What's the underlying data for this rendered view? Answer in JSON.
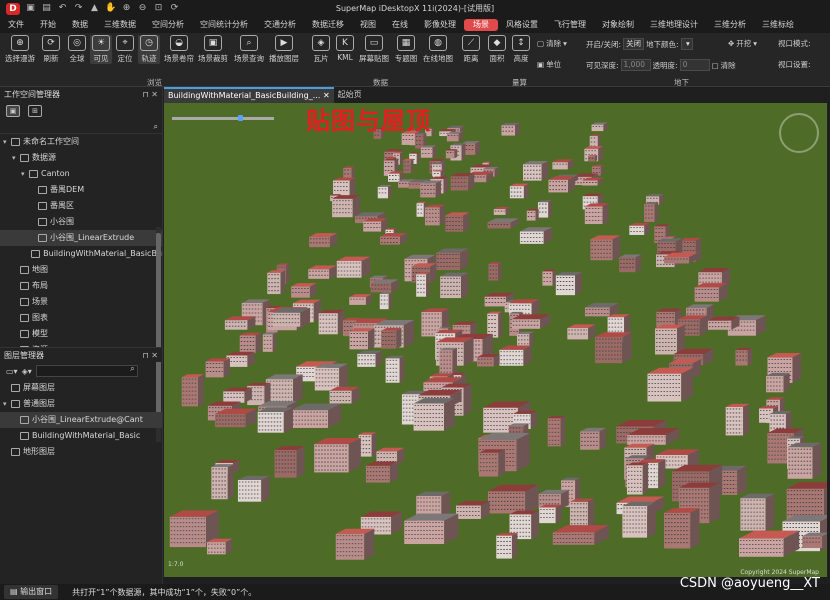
{
  "window": {
    "title": "SuperMap iDesktopX 11i(2024)-[试用版]",
    "logo": "D"
  },
  "quick_access": [
    "save-icon",
    "open-icon",
    "undo-icon",
    "redo-icon",
    "select-icon",
    "pan-icon",
    "zoom-in-icon",
    "zoom-out-icon",
    "fit-icon",
    "refresh-icon"
  ],
  "menu": [
    "文件",
    "开始",
    "数据",
    "三维数据",
    "空间分析",
    "空间统计分析",
    "交通分析",
    "数据迁移",
    "视图",
    "在线",
    "影像处理",
    "场景",
    "风格设置",
    "飞行管理",
    "对象绘制",
    "三维地理设计",
    "三维分析",
    "三维标绘"
  ],
  "active_menu": "场景",
  "ribbon": {
    "buttons": [
      "选择漫游",
      "刷新",
      "全球",
      "可见",
      "定位",
      "轨迹",
      "场景卷帘",
      "场景裁剪",
      "场景查询",
      "播放图层",
      "瓦片",
      "KML",
      "屏幕贴图",
      "专题图",
      "在线地图",
      "距离",
      "面积",
      "高度"
    ],
    "small": {
      "clear": "清除",
      "unit": "单位",
      "open_close_label": "开启/关闭:",
      "open_close_value": "关闭",
      "underground_color": "地下颜色:",
      "open": "开挖",
      "visible_depth": "可见深度:",
      "depth_value": "1,000",
      "transparency": "透明度:",
      "trans_value": "0",
      "clear2": "清除",
      "viewport_mode": "视口模式:",
      "viewport_setting": "视口设置:"
    },
    "groups": [
      "浏览",
      "数据",
      "量算",
      "地下"
    ]
  },
  "workspace": {
    "title": "工作空间管理器",
    "items": [
      {
        "label": "未命名工作空间",
        "level": 0,
        "arrow": "▾"
      },
      {
        "label": "数据源",
        "level": 1,
        "arrow": "▾"
      },
      {
        "label": "Canton",
        "level": 2,
        "arrow": "▾"
      },
      {
        "label": "番禺DEM",
        "level": 3,
        "arrow": ""
      },
      {
        "label": "番禺区",
        "level": 3,
        "arrow": ""
      },
      {
        "label": "小谷围",
        "level": 3,
        "arrow": ""
      },
      {
        "label": "小谷围_LinearExtrude",
        "level": 3,
        "arrow": "",
        "selected": true
      },
      {
        "label": "BuildingWithMaterial_BasicBu",
        "level": 3,
        "arrow": ""
      },
      {
        "label": "地图",
        "level": 1,
        "arrow": ""
      },
      {
        "label": "布局",
        "level": 1,
        "arrow": ""
      },
      {
        "label": "场景",
        "level": 1,
        "arrow": ""
      },
      {
        "label": "图表",
        "level": 1,
        "arrow": ""
      },
      {
        "label": "模型",
        "level": 1,
        "arrow": ""
      },
      {
        "label": "资源",
        "level": 1,
        "arrow": ""
      }
    ]
  },
  "layers": {
    "title": "图层管理器",
    "items": [
      {
        "label": "屏幕图层",
        "level": 0,
        "arrow": ""
      },
      {
        "label": "普通图层",
        "level": 0,
        "arrow": "▾"
      },
      {
        "label": "小谷围_LinearExtrude@Cant",
        "level": 1,
        "arrow": "",
        "selected": true
      },
      {
        "label": "BuildingWithMaterial_Basic",
        "level": 1,
        "arrow": ""
      },
      {
        "label": "地形图层",
        "level": 0,
        "arrow": ""
      }
    ]
  },
  "tabs": [
    "BuildingWithMaterial_BasicBuilding_...",
    "起始页"
  ],
  "scene": {
    "title": "贴图与屋顶",
    "scale": "1:7.0",
    "copyright": "Copyright 2024 SuperMap"
  },
  "status": {
    "output_tab": "输出窗口",
    "message": "共打开“1”个数据源，其中成功“1”个，失败“0”个。"
  },
  "watermark": "CSDN @aoyueng__XT",
  "colors": {
    "accent": "#e04a4a",
    "ground": "#4e6c27",
    "tab_indicator": "#4a9de0"
  }
}
